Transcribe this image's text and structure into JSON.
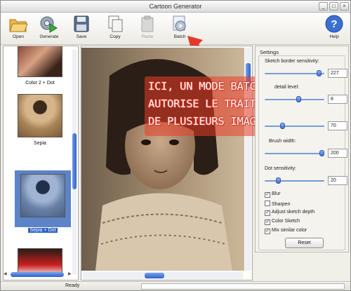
{
  "window": {
    "title": "Cartoon Generator"
  },
  "toolbar": {
    "items": [
      {
        "label": "Open",
        "icon": "folder-open-icon",
        "enabled": true
      },
      {
        "label": "Generate",
        "icon": "gear-play-icon",
        "enabled": true
      },
      {
        "label": "Save",
        "icon": "floppy-disk-icon",
        "enabled": true
      },
      {
        "label": "Copy",
        "icon": "copy-icon",
        "enabled": true
      },
      {
        "label": "Paste",
        "icon": "clipboard-icon",
        "enabled": false
      },
      {
        "label": "Batch",
        "icon": "batch-gear-icon",
        "enabled": true
      },
      {
        "label": "Help",
        "icon": "help-question-icon",
        "enabled": true
      }
    ]
  },
  "thumbnails": {
    "items": [
      {
        "caption": "Color 2 + Dot",
        "selected": false
      },
      {
        "caption": "Sepia",
        "selected": false
      },
      {
        "caption": "Sepia + Dot",
        "selected": true
      },
      {
        "caption": "",
        "selected": false
      }
    ]
  },
  "annotation": {
    "lines": [
      "ICI, UN MODE BATCH QUI",
      "AUTORISE LE TRAITEMENT",
      "DE PLUSIEURS IMAGES"
    ],
    "color": "#e23b2a"
  },
  "settings": {
    "title": "Settings",
    "sliders": [
      {
        "label": "Sketch border sensitivity:",
        "value": "227",
        "level": 0.89
      },
      {
        "label": "detail level:",
        "value": "8",
        "level": 0.55
      },
      {
        "label": "",
        "value": "70",
        "level": 0.28
      },
      {
        "label": "Brush width:",
        "value": "200",
        "level": 0.93
      },
      {
        "label": "Dot sensitivity:",
        "value": "20",
        "level": 0.2
      }
    ],
    "checkboxes": [
      {
        "label": "Blur",
        "checked": true
      },
      {
        "label": "Sharpen",
        "checked": false
      },
      {
        "label": "Adjust sketch depth",
        "checked": true
      },
      {
        "label": "Color Sketch",
        "checked": true
      },
      {
        "label": "Mix similar color",
        "checked": true
      }
    ],
    "reset_label": "Reset"
  },
  "status": {
    "text": "Ready"
  },
  "colors": {
    "accent": "#2f62c4",
    "annotation_red": "#e23b2a",
    "sepia": "#b89a74"
  }
}
